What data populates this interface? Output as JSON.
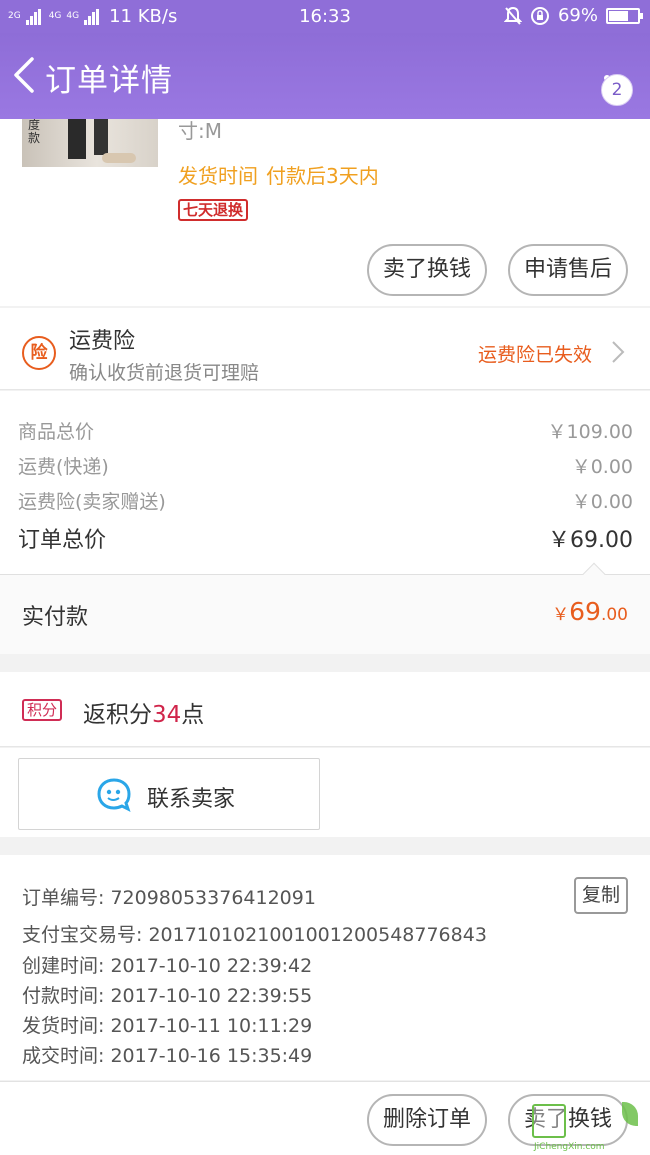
{
  "status_bar": {
    "network_small": "2G",
    "network_mid": "4G",
    "network_mid2": "4G",
    "speed": "11 KB/s",
    "time": "16:33",
    "battery": "69%",
    "battery_level": 0.69,
    "icons": [
      "bell-off-icon",
      "lock-rotation-icon"
    ]
  },
  "nav": {
    "title": "订单详情",
    "back_icon": "chevron-left-icon",
    "more_icon": "more-vertical-icon",
    "message_count": "2"
  },
  "product": {
    "thumb_text": "度款",
    "sku": "寸:M",
    "ship_label": "发货时间",
    "ship_value": "付款后3天内",
    "return_tag": "七天退换",
    "actions": {
      "sell": "卖了换钱",
      "after_sales": "申请售后"
    }
  },
  "insurance": {
    "icon_char": "险",
    "title": "运费险",
    "subtitle": "确认收货前退货可理赔",
    "status": "运费险已失效"
  },
  "prices": {
    "rows": [
      {
        "label": "商品总价",
        "value": "￥109.00"
      },
      {
        "label": "运费(快递)",
        "value": "￥0.00"
      },
      {
        "label": "运费险(卖家赠送)",
        "value": "￥0.00"
      }
    ],
    "total_label": "订单总价",
    "total_value": "￥69.00",
    "paid_label": "实付款",
    "paid_currency": "￥",
    "paid_int": "69",
    "paid_dec": ".00"
  },
  "points": {
    "tag": "积分",
    "text_before": "返积分",
    "count": "34",
    "text_after": "点"
  },
  "contact": {
    "label": "联系卖家",
    "icon": "chat-bubble-icon"
  },
  "order_info": {
    "order_no": "订单编号: 72098053376412091",
    "copy": "复制",
    "alipay_no": "支付宝交易号: 2017101021001001200548776843",
    "created": "创建时间: 2017-10-10 22:39:42",
    "paid": "付款时间: 2017-10-10 22:39:55",
    "shipped": "发货时间: 2017-10-11 10:11:29",
    "completed": "成交时间: 2017-10-16 15:35:49"
  },
  "bottom_actions": {
    "delete": "删除订单",
    "sell": "卖了换钱"
  },
  "watermark": {
    "text": "JiChengXin.com"
  },
  "colors": {
    "header": "#8f6ed8",
    "accent_orange": "#e85d1e",
    "ship_yellow": "#f0a020",
    "tag_red": "#d02d2d",
    "points_red": "#d0254a",
    "contact_blue": "#2aa6e8"
  }
}
